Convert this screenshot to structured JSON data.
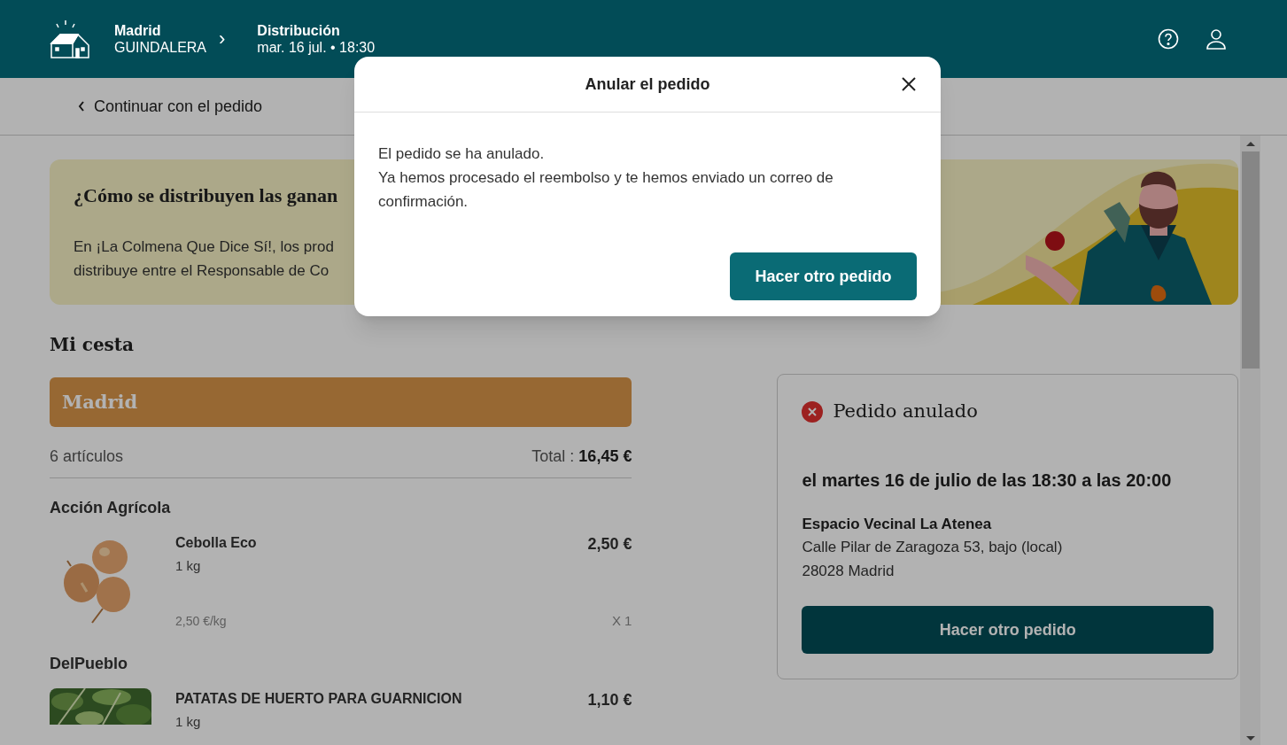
{
  "header": {
    "hive_city": "Madrid",
    "hive_name": "GUINDALERA",
    "separator": "›",
    "distribution_label": "Distribución",
    "distribution_date": "mar. 16 jul. • 18:30"
  },
  "subheader": {
    "back_link": "Continuar con el pedido"
  },
  "banner": {
    "title": "¿Cómo se distribuyen las ganan",
    "lines": [
      "En ¡La Colmena Que Dice Sí!, los prod",
      "distribuye entre el Responsable de Co"
    ]
  },
  "basket": {
    "title": "Mi cesta",
    "hive": "Madrid",
    "count": "6 artículos",
    "total_label": "Total :",
    "total": "16,45 €",
    "groups": [
      {
        "producer": "Acción Agrícola",
        "items": [
          {
            "name": "Cebolla Eco",
            "unit": "1 kg",
            "price": "2,50 €",
            "unit_price": "2,50 €/kg",
            "quantity": "X 1"
          }
        ]
      },
      {
        "producer": "DelPueblo",
        "items": [
          {
            "name": "PATATAS DE HUERTO PARA GUARNICION",
            "unit": "1 kg",
            "price": "1,10 €"
          }
        ]
      }
    ]
  },
  "order_status": {
    "title": "Pedido anulado",
    "when": "el martes 16 de julio de las 18:30 a las 20:00",
    "place": "Espacio Vecinal La Atenea",
    "address": [
      "Calle Pilar de Zaragoza 53, bajo (local)",
      "28028 Madrid"
    ],
    "button": "Hacer otro pedido"
  },
  "modal": {
    "title": "Anular el pedido",
    "lines": [
      "El pedido se ha anulado.",
      "Ya hemos procesado el reembolso y te hemos enviado un correo de confirmación."
    ],
    "button": "Hacer otro pedido"
  }
}
